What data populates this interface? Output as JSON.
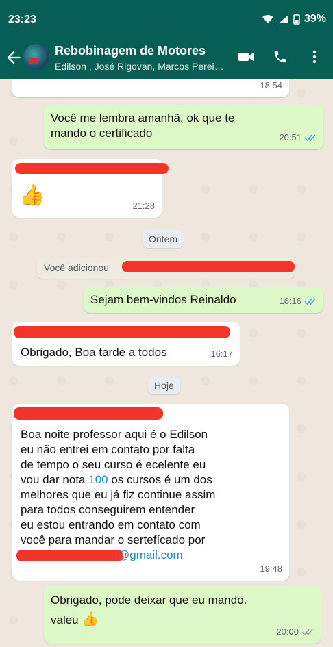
{
  "status_bar": {
    "time": "23:23",
    "battery": "39%"
  },
  "header": {
    "title": "Rebobinagem de Motores",
    "subtitle": "Edilson , José Rigovan, Marcos Perei…"
  },
  "messages": [
    {
      "time": "18:54"
    },
    {
      "text_line1": "Você me lembra amanhã, ok que te",
      "text_line2": "mando o certificado",
      "time": "20:51"
    },
    {
      "emoji": "👍",
      "time": "21:28"
    },
    {
      "date_chip": "Ontem"
    },
    {
      "system_text": "Você adicionou"
    },
    {
      "text": "Sejam bem-vindos Reinaldo",
      "time": "16:16"
    },
    {
      "text": "Obrigado, Boa tarde a todos",
      "time": "16:17"
    },
    {
      "date_chip": "Hoje"
    },
    {
      "line1": "Boa noite professor aqui é o Edilson",
      "line2": "eu não entrei em contato por falta",
      "line3": "de tempo o seu curso é ecelente eu",
      "line4_pre": "vou dar nota ",
      "line4_num": "100",
      "line4_post": " os cursos é um dos",
      "line5": "melhores que eu já fiz continue assim",
      "line6": "para todos conseguirem entender",
      "line7": "eu estou entrando em contato com",
      "line8": "você para mandar o sertefícado por",
      "email_visible": "@gmail.com",
      "time": "19:48"
    },
    {
      "line1": "Obrigado, pode deixar que eu mando.",
      "line2_text": "valeu",
      "line2_emoji": "👍",
      "time": "20:00"
    }
  ],
  "colors": {
    "header": "#075e54",
    "outgoing": "#dcf8c6",
    "incoming": "#ffffff",
    "redaction": "#f2342b",
    "link": "#1e88c9"
  }
}
